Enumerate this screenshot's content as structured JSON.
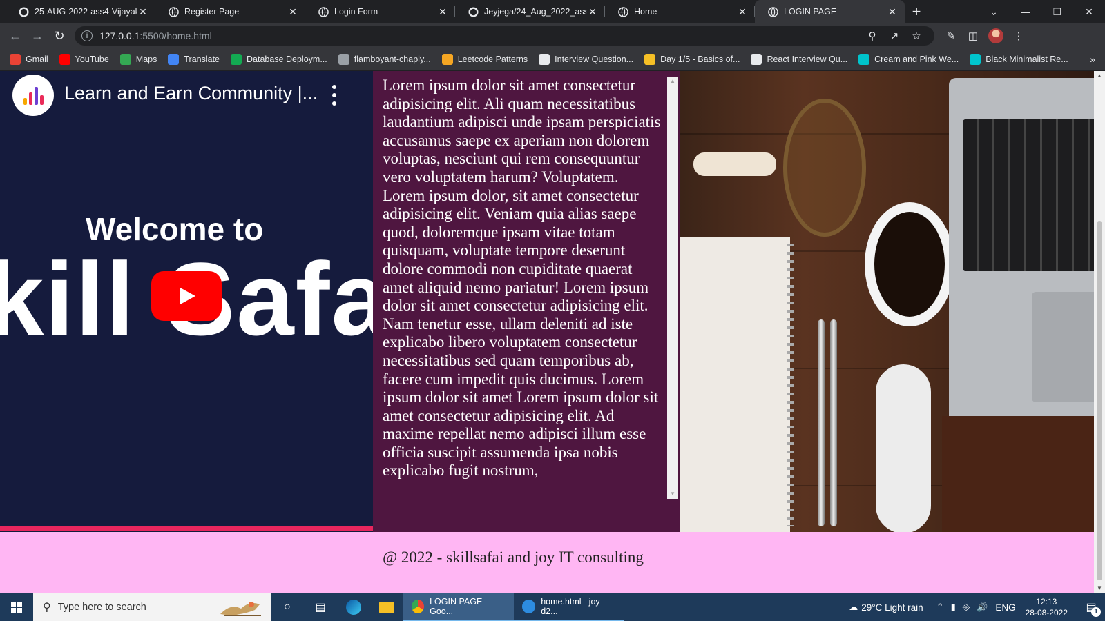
{
  "browser": {
    "tabs": [
      {
        "title": "25-AUG-2022-ass4-Vijayakun",
        "icon": "github-icon"
      },
      {
        "title": "Register Page",
        "icon": "globe-icon"
      },
      {
        "title": "Login Form",
        "icon": "globe-icon"
      },
      {
        "title": "Jeyjega/24_Aug_2022_ass3_p",
        "icon": "github-icon"
      },
      {
        "title": "Home",
        "icon": "globe-icon"
      },
      {
        "title": "LOGIN PAGE",
        "icon": "globe-icon",
        "active": true
      }
    ],
    "url_host": "127.0.0.1",
    "url_rest": ":5500/home.html",
    "bookmarks": [
      {
        "label": "Gmail",
        "color": "#ea4335"
      },
      {
        "label": "YouTube",
        "color": "#ff0000"
      },
      {
        "label": "Maps",
        "color": "#34a853"
      },
      {
        "label": "Translate",
        "color": "#4285f4"
      },
      {
        "label": "Database Deploym...",
        "color": "#13aa52"
      },
      {
        "label": "flamboyant-chaply...",
        "color": "#9aa0a6"
      },
      {
        "label": "Leetcode Patterns",
        "color": "#f5a623"
      },
      {
        "label": "Interview Question...",
        "color": "#e8eaed"
      },
      {
        "label": "Day 1/5 - Basics of...",
        "color": "#f6c026"
      },
      {
        "label": "React Interview Qu...",
        "color": "#e8eaed"
      },
      {
        "label": "Cream and Pink We...",
        "color": "#00c4cc"
      },
      {
        "label": "Black Minimalist Re...",
        "color": "#00c4cc"
      }
    ]
  },
  "page": {
    "video": {
      "title": "Learn and Earn Community |...",
      "welcome": "Welcome to",
      "brand": "kill Safa"
    },
    "lorem": "Lorem ipsum dolor sit amet consectetur adipisicing elit. Ali quam necessitatibus laudantium adipisci unde ipsam perspiciatis accusamus saepe ex aperiam non dolorem voluptas, nesciunt qui rem consequuntur vero voluptatem harum? Voluptatem. Lorem ipsum dolor, sit amet consectetur adipisicing elit. Veniam quia alias saepe quod, doloremque ipsam vitae totam quisquam, voluptate tempore deserunt dolore commodi non cupiditate quaerat amet aliquid nemo pariatur! Lorem ipsum dolor sit amet consectetur adipisicing elit. Nam tenetur esse, ullam deleniti ad iste explicabo libero voluptatem consectetur necessitatibus sed quam temporibus ab, facere cum impedit quis ducimus. Lorem ipsum dolor sit amet Lorem ipsum dolor sit amet consectetur adipisicing elit. Ad maxime repellat nemo adipisci illum esse officia suscipit assumenda ipsa nobis explicabo fugit nostrum,",
    "footer": "@ 2022 - skillsafai and joy IT consulting",
    "colors": {
      "background": "#4f1640",
      "footer": "#ffb6f3",
      "video_bg": "#151b3d"
    }
  },
  "taskbar": {
    "search_placeholder": "Type here to search",
    "tasks": [
      {
        "label": "LOGIN PAGE - Goo...",
        "icon": "chrome-icon",
        "active": true
      },
      {
        "label": "home.html - joy d2...",
        "icon": "vscode-icon",
        "active": false
      }
    ],
    "weather": "29°C  Light rain",
    "lang": "ENG",
    "time": "12:13",
    "date": "28-08-2022",
    "notifications": "1"
  }
}
